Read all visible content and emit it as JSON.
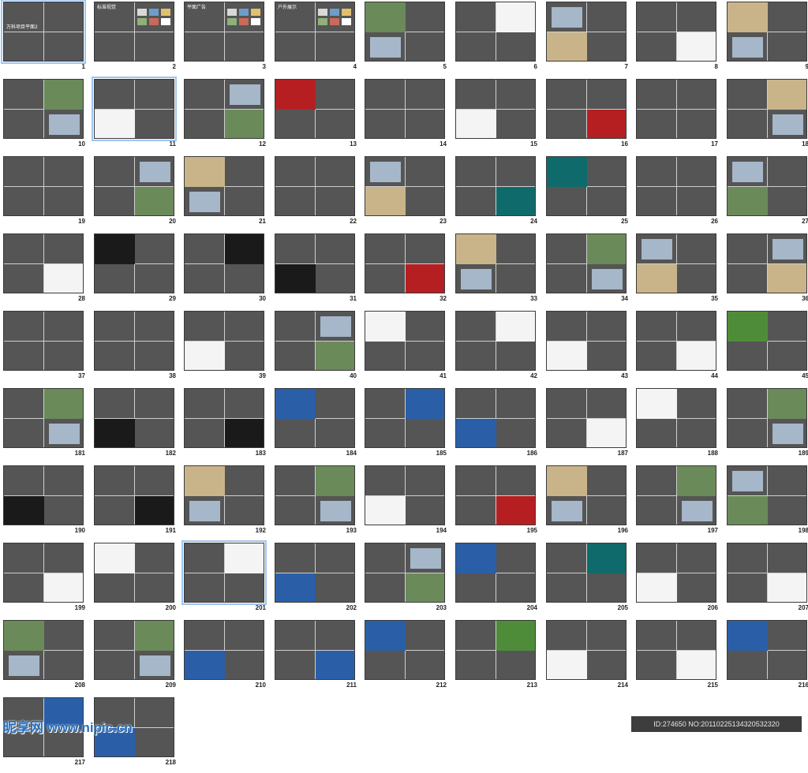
{
  "slides": [
    {
      "n": "1",
      "title": "万科项目平面2",
      "type": "title",
      "selected": true
    },
    {
      "n": "2",
      "title": "标准视觉",
      "type": "grid"
    },
    {
      "n": "3",
      "title": "平面广告",
      "type": "grid"
    },
    {
      "n": "4",
      "title": "户外展示",
      "type": "grid"
    },
    {
      "n": "5",
      "type": "photo"
    },
    {
      "n": "6",
      "type": "white"
    },
    {
      "n": "7",
      "type": "mixed"
    },
    {
      "n": "8",
      "type": "white"
    },
    {
      "n": "9",
      "type": "mixed"
    },
    {
      "n": "10",
      "type": "photo"
    },
    {
      "n": "11",
      "type": "white",
      "selected": true
    },
    {
      "n": "12",
      "type": "photo"
    },
    {
      "n": "13",
      "type": "red"
    },
    {
      "n": "14",
      "type": "quad"
    },
    {
      "n": "15",
      "type": "white"
    },
    {
      "n": "16",
      "type": "red"
    },
    {
      "n": "17",
      "type": "quad"
    },
    {
      "n": "18",
      "type": "mixed"
    },
    {
      "n": "19",
      "type": "quad"
    },
    {
      "n": "20",
      "type": "photo"
    },
    {
      "n": "21",
      "type": "mixed"
    },
    {
      "n": "22",
      "type": "quad"
    },
    {
      "n": "23",
      "type": "mixed"
    },
    {
      "n": "24",
      "type": "teal"
    },
    {
      "n": "25",
      "type": "teal"
    },
    {
      "n": "26",
      "type": "quad"
    },
    {
      "n": "27",
      "type": "photo"
    },
    {
      "n": "28",
      "type": "white"
    },
    {
      "n": "29",
      "type": "dark"
    },
    {
      "n": "30",
      "type": "dark"
    },
    {
      "n": "31",
      "type": "dark"
    },
    {
      "n": "32",
      "type": "red"
    },
    {
      "n": "33",
      "type": "mixed"
    },
    {
      "n": "34",
      "type": "photo"
    },
    {
      "n": "35",
      "type": "mixed"
    },
    {
      "n": "36",
      "type": "mixed"
    },
    {
      "n": "37",
      "type": "quad"
    },
    {
      "n": "38",
      "type": "quad"
    },
    {
      "n": "39",
      "type": "white"
    },
    {
      "n": "40",
      "type": "photo"
    },
    {
      "n": "41",
      "type": "white"
    },
    {
      "n": "42",
      "type": "white"
    },
    {
      "n": "43",
      "type": "white"
    },
    {
      "n": "44",
      "type": "white"
    },
    {
      "n": "45",
      "type": "green"
    },
    {
      "n": "181",
      "type": "photo"
    },
    {
      "n": "182",
      "type": "dark"
    },
    {
      "n": "183",
      "type": "dark"
    },
    {
      "n": "184",
      "type": "blue"
    },
    {
      "n": "185",
      "type": "blue"
    },
    {
      "n": "186",
      "type": "blue"
    },
    {
      "n": "187",
      "type": "white"
    },
    {
      "n": "188",
      "type": "white"
    },
    {
      "n": "189",
      "type": "photo"
    },
    {
      "n": "190",
      "type": "dark"
    },
    {
      "n": "191",
      "type": "dark"
    },
    {
      "n": "192",
      "type": "mixed"
    },
    {
      "n": "193",
      "type": "photo"
    },
    {
      "n": "194",
      "type": "white"
    },
    {
      "n": "195",
      "type": "red"
    },
    {
      "n": "196",
      "type": "mixed"
    },
    {
      "n": "197",
      "type": "photo"
    },
    {
      "n": "198",
      "type": "photo"
    },
    {
      "n": "199",
      "type": "white"
    },
    {
      "n": "200",
      "type": "white"
    },
    {
      "n": "201",
      "type": "white",
      "selected": true
    },
    {
      "n": "202",
      "type": "blue"
    },
    {
      "n": "203",
      "type": "photo"
    },
    {
      "n": "204",
      "type": "blue"
    },
    {
      "n": "205",
      "type": "teal"
    },
    {
      "n": "206",
      "type": "white"
    },
    {
      "n": "207",
      "type": "white"
    },
    {
      "n": "208",
      "type": "photo"
    },
    {
      "n": "209",
      "type": "photo"
    },
    {
      "n": "210",
      "type": "blue"
    },
    {
      "n": "211",
      "type": "blue"
    },
    {
      "n": "212",
      "type": "blue"
    },
    {
      "n": "213",
      "type": "green"
    },
    {
      "n": "214",
      "type": "white"
    },
    {
      "n": "215",
      "type": "white"
    },
    {
      "n": "216",
      "type": "blue"
    },
    {
      "n": "217",
      "type": "blue"
    },
    {
      "n": "218",
      "type": "blue"
    }
  ],
  "palette": {
    "photo": "#6b8a5a",
    "dark": "#1a1a1a",
    "white": "#f4f4f4",
    "red": "#b51f22",
    "teal": "#0f6b6b",
    "blue": "#2a5fa8",
    "green": "#4f8c3a",
    "mixed": "#c9b48a"
  },
  "watermark": "昵享网 www.nipic.cn",
  "image_info": "ID:274650 NO:20110225134320532320"
}
